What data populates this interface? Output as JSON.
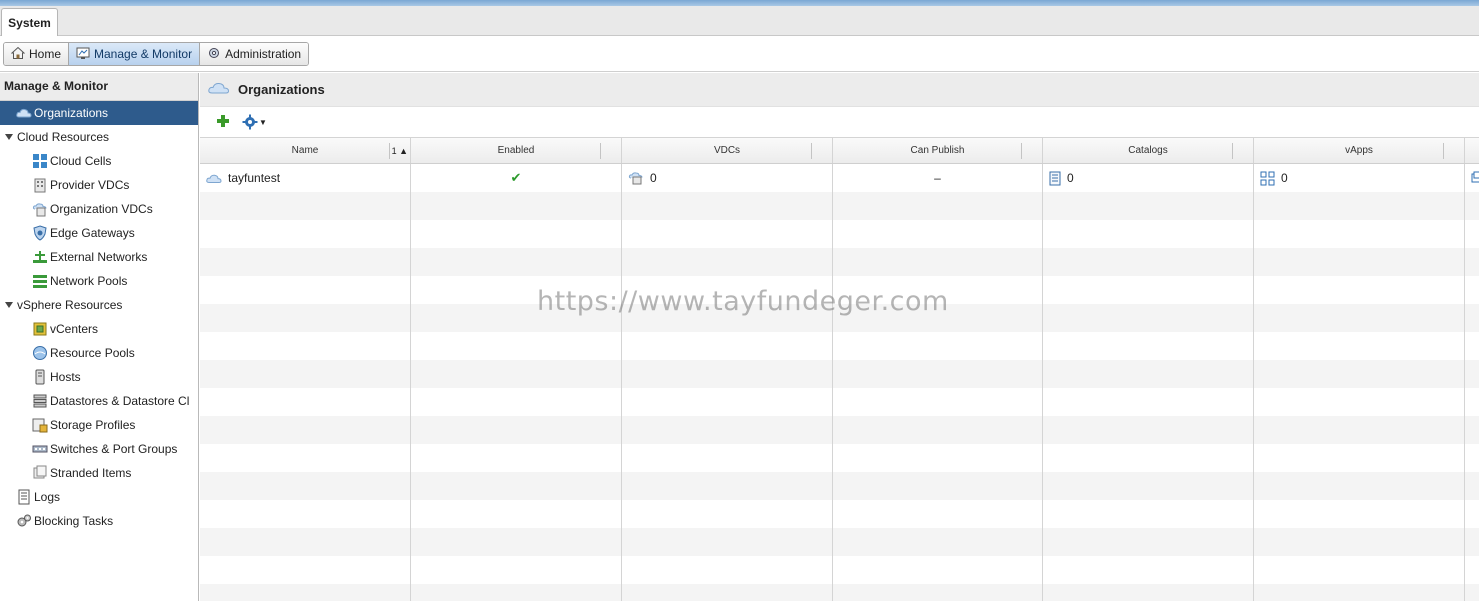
{
  "tabs": [
    {
      "label": "System"
    }
  ],
  "toolbar": {
    "home": "Home",
    "manage_monitor": "Manage & Monitor",
    "administration": "Administration"
  },
  "sidebar": {
    "title": "Manage & Monitor",
    "organizations": "Organizations",
    "cloud_resources": "Cloud Resources",
    "cloud_items": [
      "Cloud Cells",
      "Provider VDCs",
      "Organization VDCs",
      "Edge Gateways",
      "External Networks",
      "Network Pools"
    ],
    "vsphere_resources": "vSphere Resources",
    "vsphere_items": [
      "vCenters",
      "Resource Pools",
      "Hosts",
      "Datastores & Datastore Cl",
      "Storage Profiles",
      "Switches & Port Groups",
      "Stranded Items"
    ],
    "logs": "Logs",
    "blocking_tasks": "Blocking Tasks"
  },
  "main": {
    "title": "Organizations",
    "columns": [
      "Name",
      "Enabled",
      "VDCs",
      "Can Publish",
      "Catalogs",
      "vApps"
    ],
    "sort_indicator": "1 ▲",
    "rows": [
      {
        "name": "tayfuntest",
        "enabled": "✔",
        "vdcs": "0",
        "can_publish": "–",
        "catalogs": "0",
        "vapps": "0"
      }
    ]
  },
  "watermark": "https://www.tayfundeger.com",
  "colors": {
    "selection": "#2e5b8c",
    "accent": "#2f6fb3",
    "ok": "#2b9a2b"
  }
}
